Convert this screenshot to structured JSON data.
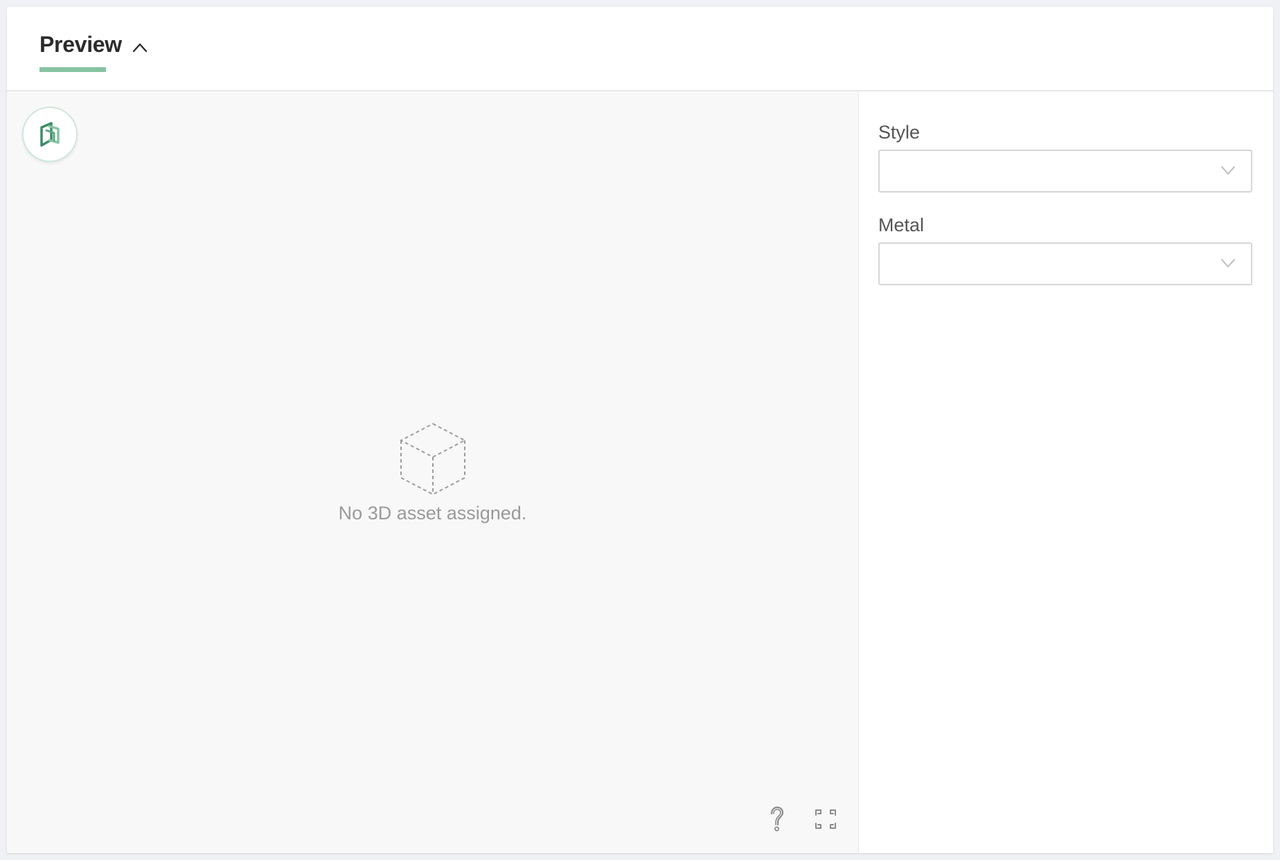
{
  "header": {
    "tab_title": "Preview"
  },
  "viewer": {
    "empty_message": "No 3D asset assigned."
  },
  "sidebar": {
    "fields": [
      {
        "label": "Style",
        "value": ""
      },
      {
        "label": "Metal",
        "value": ""
      }
    ]
  },
  "colors": {
    "accent": "#86c3a3",
    "logo_dark": "#3e8a67",
    "logo_light": "#86c3a3"
  },
  "icons": {
    "collapse": "chevron-up-icon",
    "logo": "viewer-logo-icon",
    "empty": "dashed-cube-icon",
    "help": "question-icon",
    "fullscreen": "fullscreen-icon",
    "dropdown": "chevron-down-icon"
  }
}
